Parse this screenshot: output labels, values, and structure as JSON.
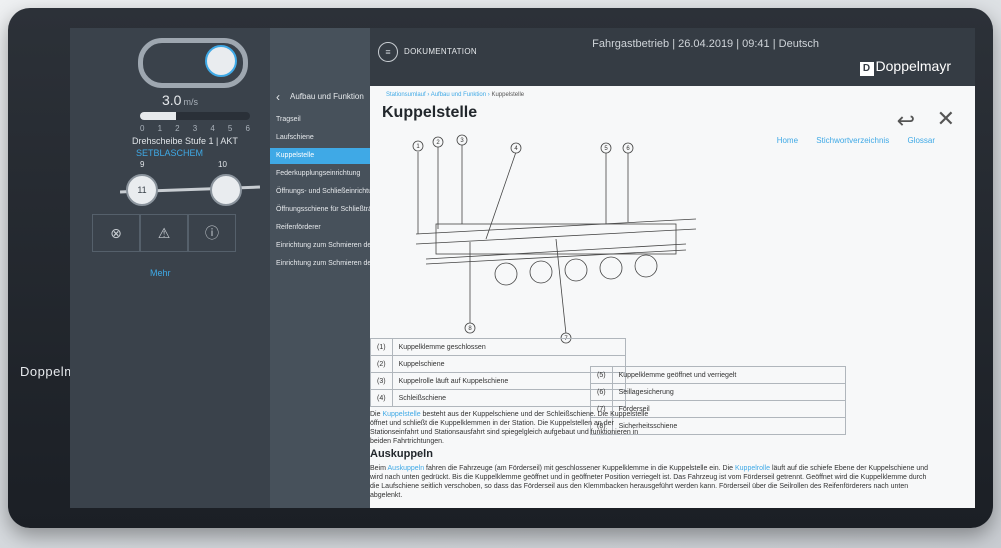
{
  "header": {
    "doc_title": "DOKUMENTATION",
    "info": "Fahrgastbetrieb | 26.04.2019 | 09:41 | Deutsch",
    "brand": "Doppelmayr"
  },
  "device": {
    "logo": "Doppelmayr"
  },
  "sidebar": {
    "speed_value": "3.0",
    "speed_unit": "m/s",
    "speed_fraction": 0.33,
    "ticks": [
      "0",
      "1",
      "2",
      "3",
      "4",
      "5",
      "6"
    ],
    "status_line": "Drehscheibe Stufe 1 | AKT",
    "status_link": "SETBLASCHEM",
    "slider_left_label": "9",
    "slider_left_value": "11",
    "slider_right_label": "10",
    "more_link": "Mehr"
  },
  "nav": {
    "title": "Aufbau und Funktion",
    "items": [
      {
        "label": "Tragseil",
        "active": false
      },
      {
        "label": "Laufschiene",
        "active": false
      },
      {
        "label": "Kuppelstelle",
        "active": true
      },
      {
        "label": "Federkupplungseinrichtung",
        "active": false
      },
      {
        "label": "Öffnungs- und Schließeinrichtung d...",
        "active": false
      },
      {
        "label": "Öffnungsschiene für Schließträger",
        "active": false
      },
      {
        "label": "Reifenförderer",
        "active": false
      },
      {
        "label": "Einrichtung zum Schmieren der Kuppelstelle",
        "active": false
      },
      {
        "label": "Einrichtung zum Schmieren der Stützrolle",
        "active": false
      }
    ]
  },
  "content": {
    "breadcrumb": [
      "Stationsumlauf",
      "Aufbau und Funktion",
      "Kuppelstelle"
    ],
    "title": "Kuppelstelle",
    "links": [
      "Home",
      "Stichwortverzeichnis",
      "Glossar"
    ],
    "callouts": [
      "1",
      "2",
      "3",
      "4",
      "5",
      "6",
      "7",
      "8"
    ],
    "legend_left": [
      {
        "num": "(1)",
        "text": "Kuppelklemme geschlossen"
      },
      {
        "num": "(2)",
        "text": "Kuppelschiene"
      },
      {
        "num": "(3)",
        "text": "Kuppelrolle läuft auf Kuppelschiene"
      },
      {
        "num": "(4)",
        "text": "Schleißschiene"
      }
    ],
    "legend_right": [
      {
        "num": "(5)",
        "text": "Kuppelklemme geöffnet und verriegelt"
      },
      {
        "num": "(6)",
        "text": "Seillagesicherung"
      },
      {
        "num": "(7)",
        "text": "Förderseil"
      },
      {
        "num": "(8)",
        "text": "Sicherheitsschiene"
      }
    ],
    "para1_pre": "Die ",
    "para1_link": "Kuppelstelle",
    "para1_post": " besteht aus der Kuppelschiene und der Schleißschiene. Die Kuppelstelle öffnet und schließt die Kuppelklemmen in der Station. Die Kuppelstellen an der Stationseinfahrt und Stationsausfahrt sind spiegelgleich aufgebaut und funktionieren in beiden Fahrtrichtungen.",
    "section_title": "Auskuppeln",
    "para2_pre": "Beim ",
    "para2_link": "Auskuppeln",
    "para2_mid": " fahren die Fahrzeuge (am Förderseil) mit geschlossener Kuppelklemme in die Kuppelstelle ein. Die ",
    "para2_link2": "Kuppelrolle",
    "para2_post": " läuft auf die schiefe Ebene der Kuppelschiene und wird nach unten gedrückt. Bis die Kuppelklemme geöffnet und in geöffneter Position verriegelt ist. Das Fahrzeug ist vom Förderseil getrennt. Geöffnet wird die Kuppelklemme durch die Laufschiene seitlich verschoben, so dass das Förderseil aus den Klemmbacken herausgeführt werden kann. Förderseil über die Seilrollen des Reifenförderers nach unten abgelenkt."
  },
  "colors": {
    "accent": "#3fa9e6",
    "panel": "#3a424b",
    "content_bg": "#f7f8f9"
  }
}
